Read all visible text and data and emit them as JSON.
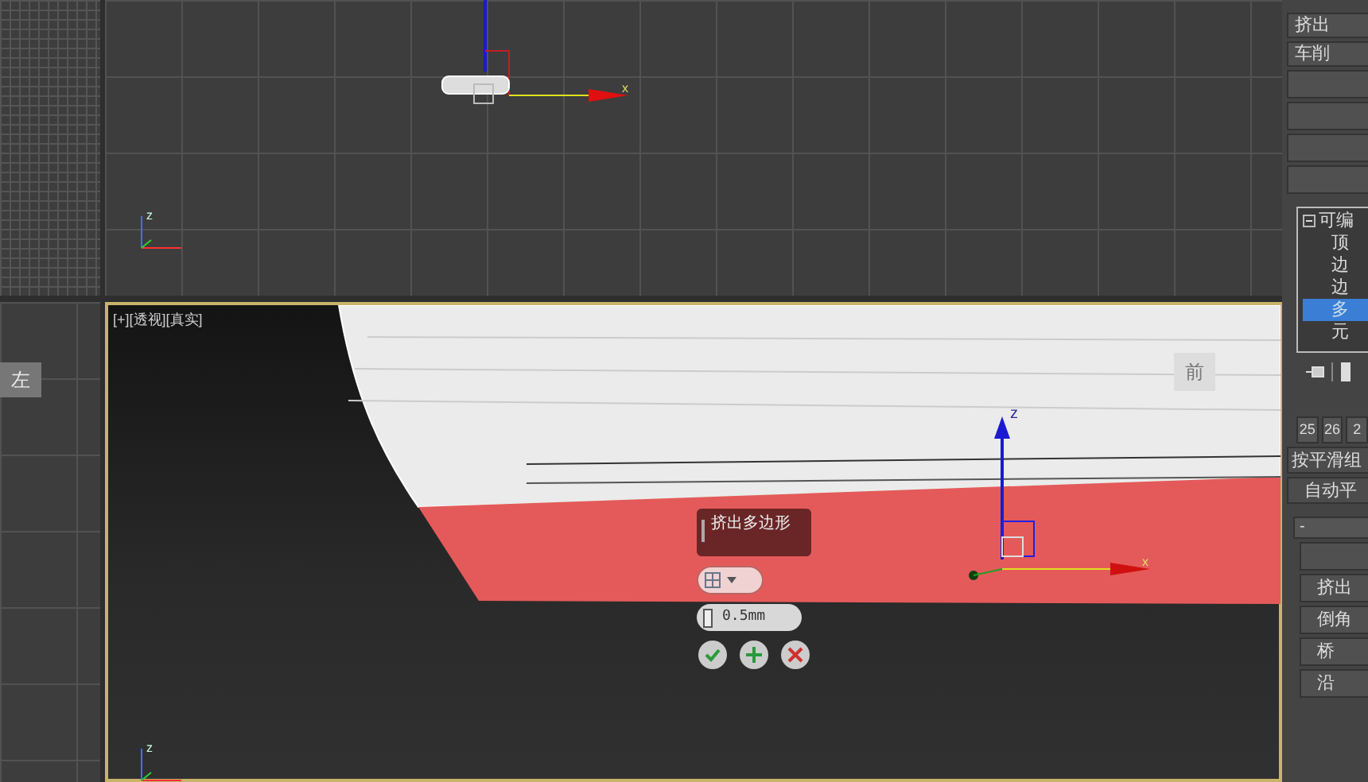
{
  "top_viewport": {
    "axis_label": "x",
    "tripod_label": "z"
  },
  "left_viewport": {
    "viewcube_label": "左"
  },
  "perspective_viewport": {
    "labels": [
      "[+]",
      "[透视]",
      "[真实]"
    ],
    "viewcube_label": "前",
    "gizmo_labels": [
      "z",
      "x"
    ],
    "tripod_label": "z",
    "caddy": {
      "title": "挤出多边形",
      "value": "0.5mm"
    }
  },
  "command_panel": {
    "top_buttons": [
      "挤出",
      "车削"
    ],
    "modifier_stack": [
      {
        "label": "可编",
        "expanded": true,
        "children": [
          {
            "label": "顶",
            "selected": false
          },
          {
            "label": "边",
            "selected": false
          },
          {
            "label": "边",
            "selected": false
          },
          {
            "label": "多",
            "selected": true
          },
          {
            "label": "元",
            "selected": false
          }
        ]
      }
    ],
    "smoothing_numbers": [
      "25",
      "26",
      "2"
    ],
    "smoothing_buttons": [
      "按平滑组",
      "自动平"
    ],
    "rollout_toggle": "-",
    "edit_buttons": [
      "挤出",
      "倒角",
      "桥",
      "沿"
    ]
  }
}
